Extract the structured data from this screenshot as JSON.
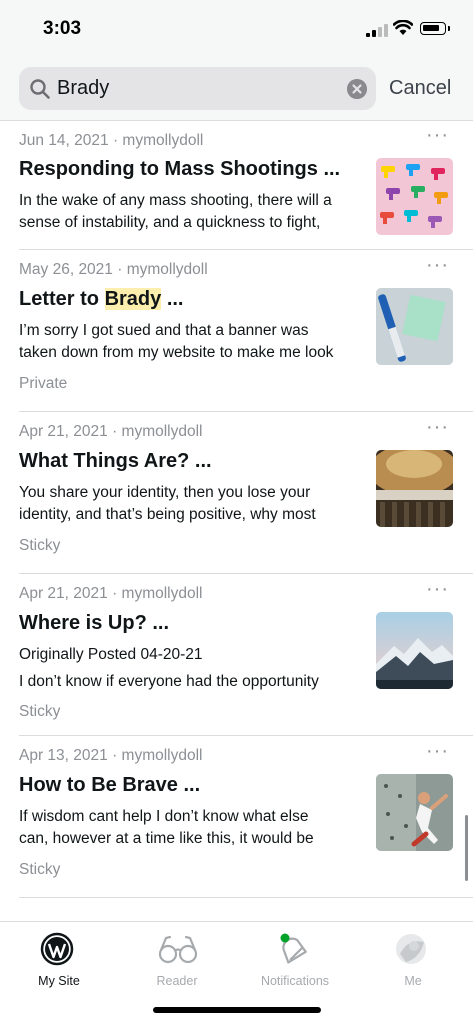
{
  "status": {
    "time": "3:03"
  },
  "search": {
    "query": "Brady",
    "cancel_label": "Cancel"
  },
  "posts": [
    {
      "meta": "Jun 14, 2021 · mymollydoll",
      "title": "Responding to Mass Shootings ...",
      "excerpt_1": "In the wake of any mass shooting, there will a",
      "excerpt_2": "sense of instability, and a quickness to fight,",
      "tag": ""
    },
    {
      "meta": "May 26, 2021 · mymollydoll",
      "title_pre": "Letter to ",
      "title_hl": "Brady",
      "title_post": " ...",
      "excerpt_1": "I’m sorry I got sued and that a banner was",
      "excerpt_2": "taken down from my website to make me look",
      "tag": "Private"
    },
    {
      "meta": "Apr 21, 2021 · mymollydoll",
      "title": "What Things Are? ...",
      "excerpt_1": "You share your identity, then you lose your",
      "excerpt_2": "identity, and that’s being positive, why most",
      "tag": "Sticky"
    },
    {
      "meta": "Apr 21, 2021 · mymollydoll",
      "title": "Where is Up? ...",
      "excerpt_1": "Originally Posted 04-20-21",
      "excerpt_2": "I don’t know if everyone had the opportunity",
      "tag": "Sticky"
    },
    {
      "meta": "Apr 13, 2021 · mymollydoll",
      "title": "How to Be Brave ...",
      "excerpt_1": "If wisdom cant help I don’t know what else",
      "excerpt_2": "can, however at a time like this, it would be",
      "tag": "Sticky"
    }
  ],
  "more_label": "···",
  "tabs": {
    "my_site": "My Site",
    "reader": "Reader",
    "notifications": "Notifications",
    "me": "Me"
  },
  "colors": {
    "highlight": "#fcefae",
    "notification_dot": "#00a32a",
    "secondary_text": "#8c8f94"
  },
  "icons": [
    "search-icon",
    "clear-icon",
    "more-icon",
    "wordpress-icon",
    "reader-glasses-icon",
    "notifications-bell-icon",
    "me-avatar-icon"
  ]
}
